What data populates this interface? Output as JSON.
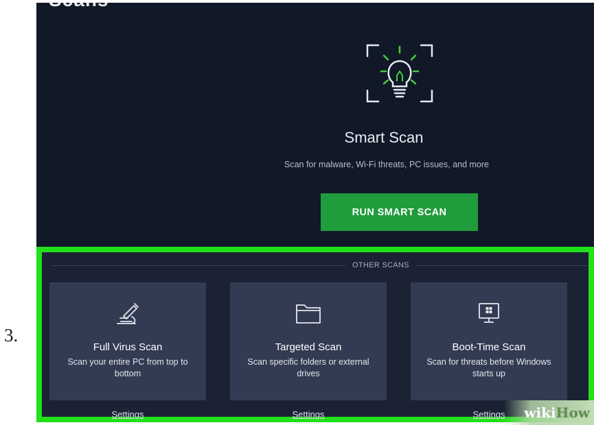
{
  "step": {
    "number": "3."
  },
  "page": {
    "heading": "Scans"
  },
  "smart_scan": {
    "icon": "lightbulb-icon",
    "title": "Smart Scan",
    "subtitle": "Scan for malware, Wi-Fi threats, PC issues, and more",
    "button_label": "RUN SMART SCAN"
  },
  "other_scans": {
    "label": "OTHER SCANS",
    "cards": [
      {
        "icon": "microscope-icon",
        "title": "Full Virus Scan",
        "description": "Scan your entire PC from top to bottom",
        "settings_label": "Settings"
      },
      {
        "icon": "folder-icon",
        "title": "Targeted Scan",
        "description": "Scan specific folders or external drives",
        "settings_label": "Settings"
      },
      {
        "icon": "monitor-windows-icon",
        "title": "Boot-Time Scan",
        "description": "Scan for threats before Windows starts up",
        "settings_label": "Settings"
      }
    ]
  },
  "watermark": {
    "text_a": "wiki",
    "text_b": "How"
  },
  "colors": {
    "background": "#111827",
    "panel": "#1a2234",
    "card": "#323b52",
    "accent_green": "#1f9c3c",
    "highlight_border": "#22e01a",
    "icon_green": "#3fd13a"
  }
}
